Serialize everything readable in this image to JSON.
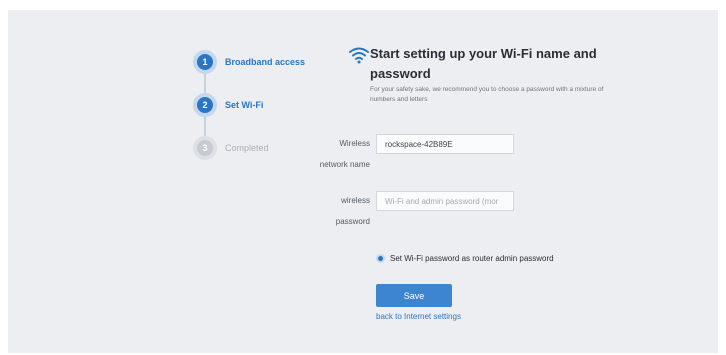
{
  "steps": [
    {
      "number": "1",
      "label": "Broadband access",
      "state": "done"
    },
    {
      "number": "2",
      "label": "Set Wi-Fi",
      "state": "current"
    },
    {
      "number": "3",
      "label": "Completed",
      "state": "pending"
    }
  ],
  "header": {
    "icon": "wifi-icon",
    "title": "Start setting up your Wi-Fi name and password",
    "subtitle": "For your safety sake, we recommend you to choose a password with a mixture of numbers and letters"
  },
  "form": {
    "network_name": {
      "label_line1": "Wireless",
      "label_line2": "network name",
      "value": "rockspace-42B89E",
      "placeholder": ""
    },
    "password": {
      "label_line1": "wireless",
      "label_line2": "password",
      "value": "",
      "placeholder": "Wi-Fi and admin password (mor"
    },
    "option_label": "Set Wi-Fi password as router admin password",
    "save_label": "Save",
    "back_link": "back to Internet settings"
  },
  "colors": {
    "accent": "#2b76c4",
    "button": "#3d86cf",
    "background": "#eceef1"
  }
}
